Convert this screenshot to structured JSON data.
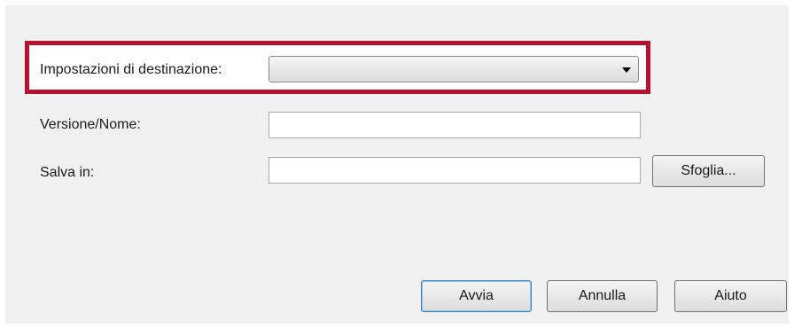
{
  "form": {
    "destination_label": "Impostazioni di destinazione:",
    "destination_value": "",
    "version_label": "Versione/Nome:",
    "version_value": "",
    "save_label": "Salva in:",
    "save_value": "",
    "browse_label": "Sfoglia..."
  },
  "buttons": {
    "start_label": "Avvia",
    "cancel_label": "Annulla",
    "help_label": "Aiuto"
  },
  "colors": {
    "highlight": "#b5122f",
    "dialog_background": "#f0f0f0",
    "default_button_border": "#3c7fb1"
  },
  "icons": {
    "dropdown": "chevron-down-icon"
  }
}
